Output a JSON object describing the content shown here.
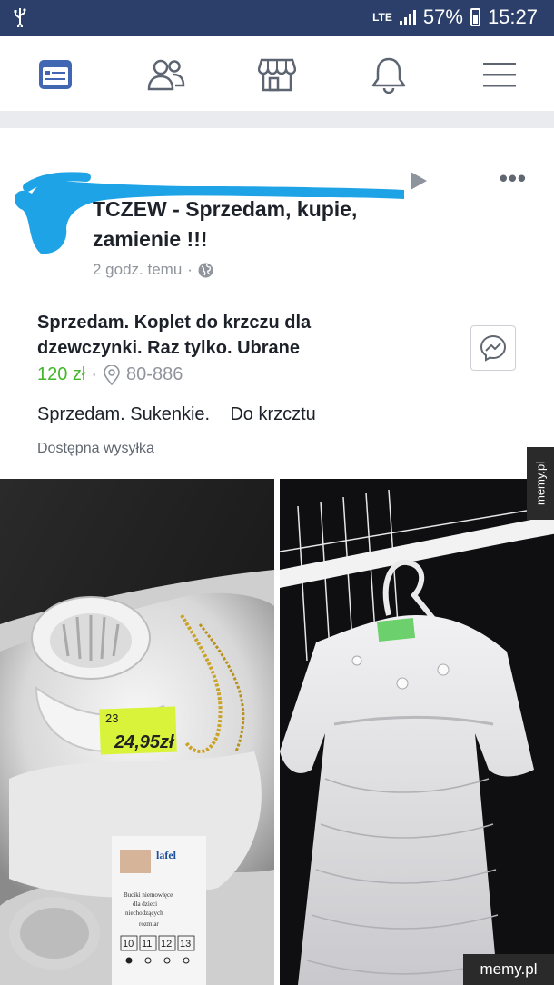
{
  "status_bar": {
    "network": "LTE",
    "battery": "57%",
    "time": "15:27"
  },
  "nav": {
    "tabs": [
      {
        "icon": "news-feed-icon",
        "active": true
      },
      {
        "icon": "friends-icon",
        "active": false
      },
      {
        "icon": "marketplace-icon",
        "active": false
      },
      {
        "icon": "bell-icon",
        "active": false
      },
      {
        "icon": "menu-icon",
        "active": false
      }
    ],
    "active_color": "#4267b2",
    "inactive_color": "#5d6572"
  },
  "post": {
    "group_name": "TCZEW - Sprzedam, kupie, zamienie !!!",
    "time": "2 godz. temu",
    "privacy_icon": "globe-icon",
    "listing_title": "Sprzedam. Koplet do krzczu dla dzewczynki.   Raz tylko. Ubrane",
    "price": "120 zł",
    "location": "80-886",
    "description": "Sprzedam. Sukenkie.    Do krzcztu",
    "shipping": "Dostępna wysyłka"
  },
  "photos": {
    "left": {
      "price_tag_line1": "23",
      "price_tag_line2": "24,95",
      "price_tag_suffix": "zł",
      "label_brand": "lafel",
      "label_text": "Buciki niemowlęce dla dzieci niechodzących",
      "label_sub": "rozmiar",
      "sizes": [
        "10",
        "11",
        "12",
        "13"
      ]
    }
  },
  "watermark": {
    "side": "memy.pl",
    "bottom": "memy.pl"
  }
}
